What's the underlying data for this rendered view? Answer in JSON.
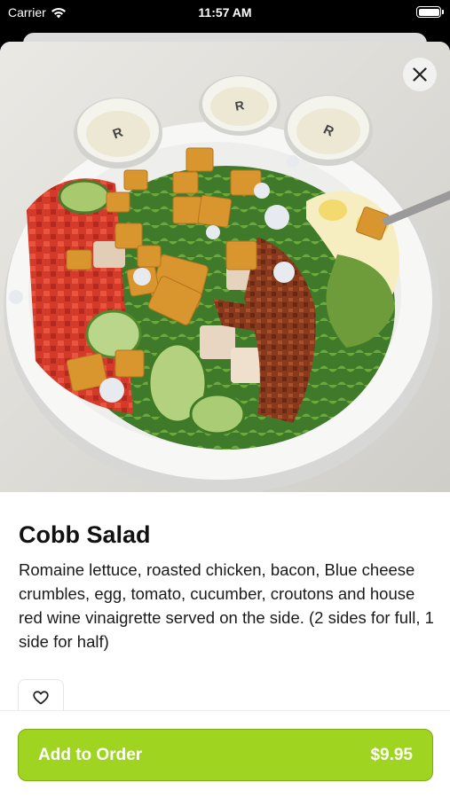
{
  "status_bar": {
    "carrier": "Carrier",
    "time": "11:57 AM"
  },
  "item": {
    "title": "Cobb Salad",
    "description": "Romaine lettuce, roasted chicken, bacon, Blue cheese crumbles, egg, tomato, cucumber, croutons and house red wine vinaigrette served on the side. (2 sides for full, 1 side for half)",
    "price": "$9.95"
  },
  "actions": {
    "add_to_order": "Add to Order"
  },
  "photo": {
    "cup_label": "R"
  },
  "icons": {
    "close": "close-icon",
    "favorite": "heart-icon",
    "wifi": "wifi-icon",
    "battery": "battery-icon"
  },
  "colors": {
    "accent": "#9fd521"
  }
}
